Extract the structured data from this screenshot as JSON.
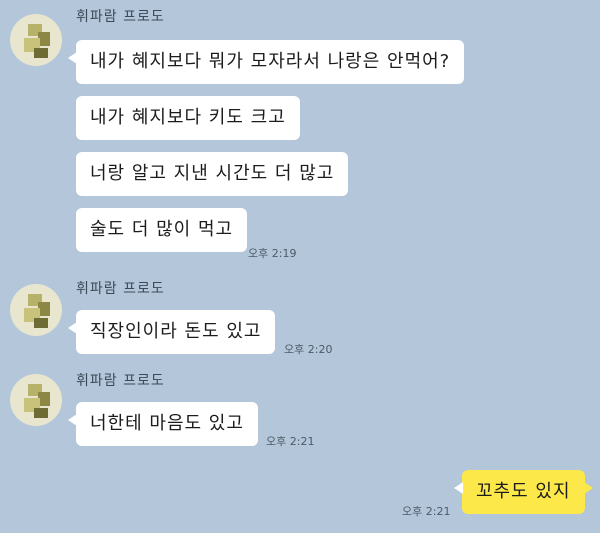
{
  "chat": {
    "groups": [
      {
        "sender": "휘파람 프로도",
        "messages": [
          "내가 혜지보다 뭐가 모자라서 나랑은 안먹어?",
          "내가 혜지보다 키도 크고",
          "너랑 알고 지낸 시간도 더 많고",
          "술도 더 많이 먹고"
        ],
        "time": "오후 2:19"
      },
      {
        "sender": "휘파람 프로도",
        "messages": [
          "직장인이라 돈도 있고"
        ],
        "time": "오후 2:20"
      },
      {
        "sender": "휘파람 프로도",
        "messages": [
          "너한테 마음도 있고"
        ],
        "time": "오후 2:21"
      }
    ],
    "mine": {
      "message": "꼬추도 있지",
      "time": "오후 2:21"
    }
  },
  "colors": {
    "background": "#b3c6da",
    "incoming_bubble": "#ffffff",
    "outgoing_bubble": "#fde84a"
  }
}
